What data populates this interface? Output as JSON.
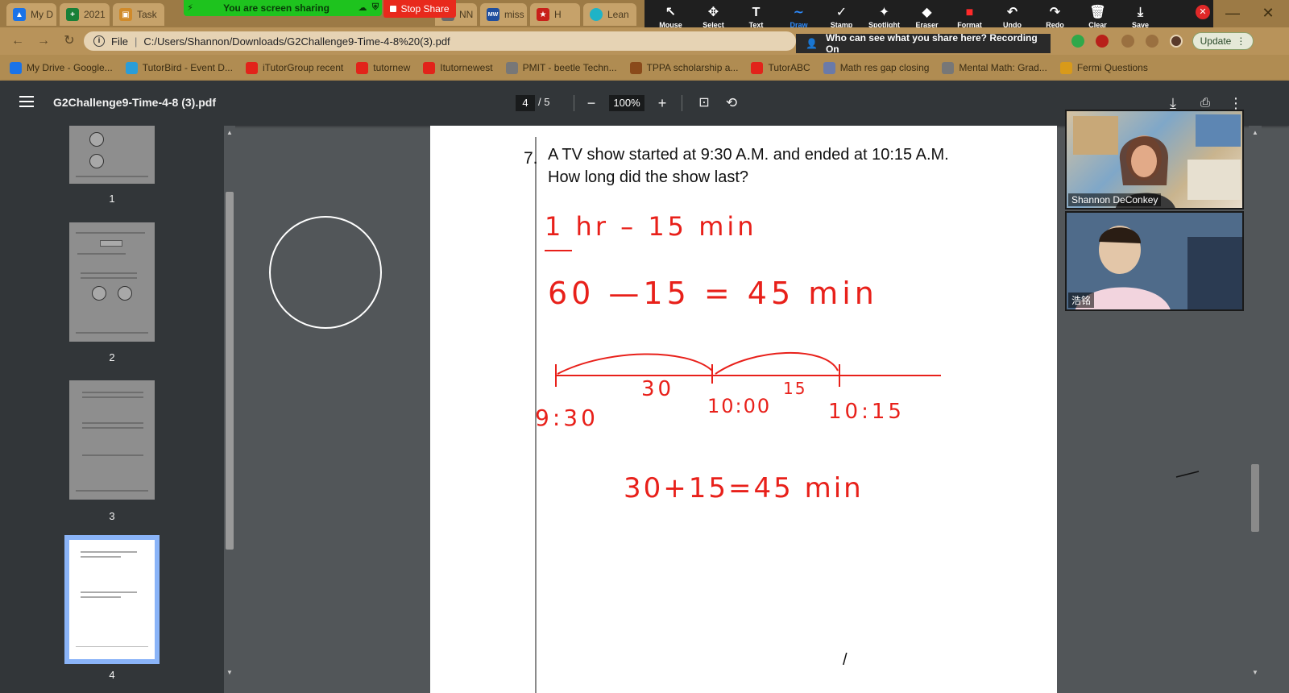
{
  "browser": {
    "tabs": [
      {
        "label": "My D",
        "icon": "google-drive-icon",
        "color": "#1a73e8"
      },
      {
        "label": "2021",
        "icon": "google-sheets-icon",
        "color": "#188038"
      },
      {
        "label": "Task",
        "icon": "task-icon",
        "color": "#d08a2a"
      },
      {
        "label": "NN",
        "icon": "doc-icon",
        "color": "#6a6a6a"
      },
      {
        "label": "miss",
        "icon": "mw-icon",
        "color": "#1f4e9e"
      },
      {
        "label": "H",
        "icon": "star-icon",
        "color": "#c8201a"
      },
      {
        "label": "Lean",
        "icon": "lean-icon",
        "color": "#1fb3c7"
      }
    ],
    "url_scheme": "File",
    "url": "C:/Users/Shannon/Downloads/G2Challenge9-Time-4-8%20(3).pdf",
    "update_label": "Update",
    "bookmarks": [
      {
        "label": "My Drive - Google...",
        "color": "#1a73e8"
      },
      {
        "label": "TutorBird - Event D...",
        "color": "#2a9dd8"
      },
      {
        "label": "iTutorGroup recent",
        "color": "#e2231a"
      },
      {
        "label": "tutornew",
        "color": "#e2231a"
      },
      {
        "label": "Itutornewest",
        "color": "#e2231a"
      },
      {
        "label": "PMIT - beetle Techn...",
        "color": "#777777"
      },
      {
        "label": "TPPA scholarship a...",
        "color": "#8a4a1a"
      },
      {
        "label": "TutorABC",
        "color": "#e2231a"
      },
      {
        "label": "Math res gap closing",
        "color": "#6a7aa8"
      },
      {
        "label": "Mental Math: Grad...",
        "color": "#777777"
      },
      {
        "label": "Fermi Questions",
        "color": "#d89a1a"
      }
    ]
  },
  "zoom": {
    "share_banner": "You are screen sharing",
    "stop_share": "Stop Share",
    "recording_notice": "Who can see what you share here? Recording On",
    "annotate_tools": [
      {
        "label": "Mouse",
        "glyph": "↖",
        "icon": "mouse-pointer-icon"
      },
      {
        "label": "Select",
        "glyph": "✥",
        "icon": "select-move-icon"
      },
      {
        "label": "Text",
        "glyph": "T",
        "icon": "text-icon"
      },
      {
        "label": "Draw",
        "glyph": "∼",
        "icon": "draw-icon"
      },
      {
        "label": "Stamp",
        "glyph": "✓",
        "icon": "stamp-icon"
      },
      {
        "label": "Spotlight",
        "glyph": "✦",
        "icon": "spotlight-icon"
      },
      {
        "label": "Eraser",
        "glyph": "◆",
        "icon": "eraser-icon"
      },
      {
        "label": "Format",
        "glyph": "■",
        "icon": "format-icon"
      },
      {
        "label": "Undo",
        "glyph": "↶",
        "icon": "undo-icon"
      },
      {
        "label": "Redo",
        "glyph": "↷",
        "icon": "redo-icon"
      },
      {
        "label": "Clear",
        "glyph": "🗑",
        "icon": "trash-icon"
      },
      {
        "label": "Save",
        "glyph": "⤓",
        "icon": "save-icon"
      }
    ],
    "participants": [
      {
        "name": "Shannon DeConkey"
      },
      {
        "name": "浩铭"
      }
    ]
  },
  "pdf": {
    "title": "G2Challenge9-Time-4-8 (3).pdf",
    "current_page": "4",
    "total_pages": "/ 5",
    "zoom": "100%",
    "thumbnails": [
      "1",
      "2",
      "3",
      "4"
    ]
  },
  "worksheet": {
    "question_number": "7.",
    "question_line1": "A TV show started at 9:30 A.M. and ended at 10:15 A.M.",
    "question_line2": "How long did the show last?"
  },
  "annotations": {
    "line1": "1 hr  –  15 min",
    "line2": "60  —15  =  45  min",
    "numberline_labels": [
      "9:30",
      "10:00",
      "10:15"
    ],
    "numberline_jumps": [
      "30",
      "15"
    ],
    "line3": "30+15=45 min",
    "ink_color": "#e8201a"
  }
}
